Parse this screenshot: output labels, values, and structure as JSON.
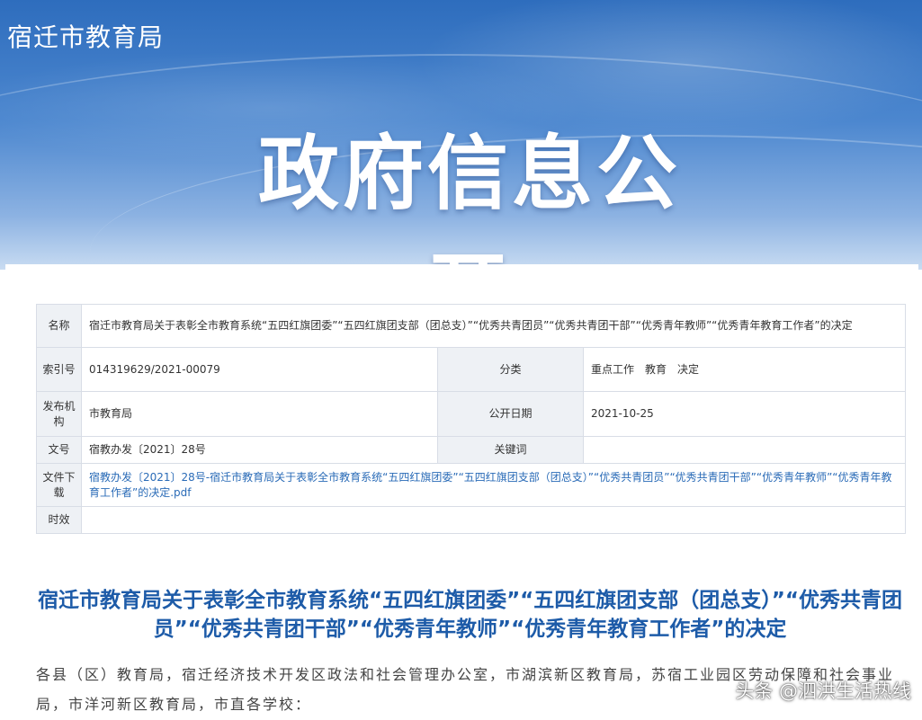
{
  "banner": {
    "site_title": "宿迁市教育局",
    "title": "政府信息公开"
  },
  "meta": {
    "name_label": "名称",
    "name_value": "宿迁市教育局关于表彰全市教育系统“五四红旗团委”“五四红旗团支部（团总支）”“优秀共青团员”“优秀共青团干部”“优秀青年教师”“优秀青年教育工作者”的决定",
    "index_label": "索引号",
    "index_value": "014319629/2021-00079",
    "category_label": "分类",
    "category_value": "重点工作　教育　决定",
    "issuer_label": "发布机构",
    "issuer_value": "市教育局",
    "date_label": "公开日期",
    "date_value": "2021-10-25",
    "docno_label": "文号",
    "docno_value": "宿教办发〔2021〕28号",
    "keywords_label": "关键词",
    "keywords_value": "",
    "download_label": "文件下载",
    "download_value": "宿教办发〔2021〕28号-宿迁市教育局关于表彰全市教育系统“五四红旗团委”“五四红旗团支部（团总支）”“优秀共青团员”“优秀共青团干部”“优秀青年教师”“优秀青年教育工作者”的决定.pdf",
    "validity_label": "时效",
    "validity_value": ""
  },
  "document": {
    "title": "宿迁市教育局关于表彰全市教育系统“五四红旗团委”“五四红旗团支部（团总支）”“优秀共青团员”“优秀共青团干部”“优秀青年教师”“优秀青年教育工作者”的决定",
    "body": "各县（区）教育局，宿迁经济技术开发区政法和社会管理办公室，市湖滨新区教育局，苏宿工业园区劳动保障和社会事业局，市洋河新区教育局，市直各学校："
  },
  "watermark": "头条 @泗洪生活热线",
  "colors": {
    "banner_blue": "#2e6dbd",
    "title_blue": "#1d5ba8",
    "link_blue": "#2a6bb7"
  }
}
